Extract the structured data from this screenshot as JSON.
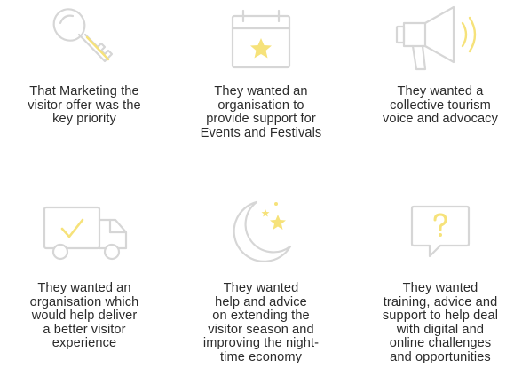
{
  "colors": {
    "icon_outline": "#d6d6d6",
    "icon_accent": "#f6e27a",
    "text": "#2b2b2b"
  },
  "cards": [
    {
      "icon": "key-icon",
      "text": "That Marketing the\nvisitor offer was the\nkey priority"
    },
    {
      "icon": "calendar-star-icon",
      "text": "They wanted an\norganisation to\nprovide support for\nEvents and Festivals"
    },
    {
      "icon": "megaphone-icon",
      "text": "They wanted a\ncollective tourism\nvoice and advocacy"
    },
    {
      "icon": "delivery-truck-icon",
      "text": "They wanted an\norganisation which\nwould help deliver\na better visitor\nexperience"
    },
    {
      "icon": "moon-stars-icon",
      "text": "They wanted\nhelp and advice\non extending the\nvisitor season and\nimproving the night-\ntime economy"
    },
    {
      "icon": "question-bubble-icon",
      "text": "They wanted\ntraining, advice and\nsupport to help deal\nwith digital and\nonline challenges\nand opportunities"
    }
  ]
}
